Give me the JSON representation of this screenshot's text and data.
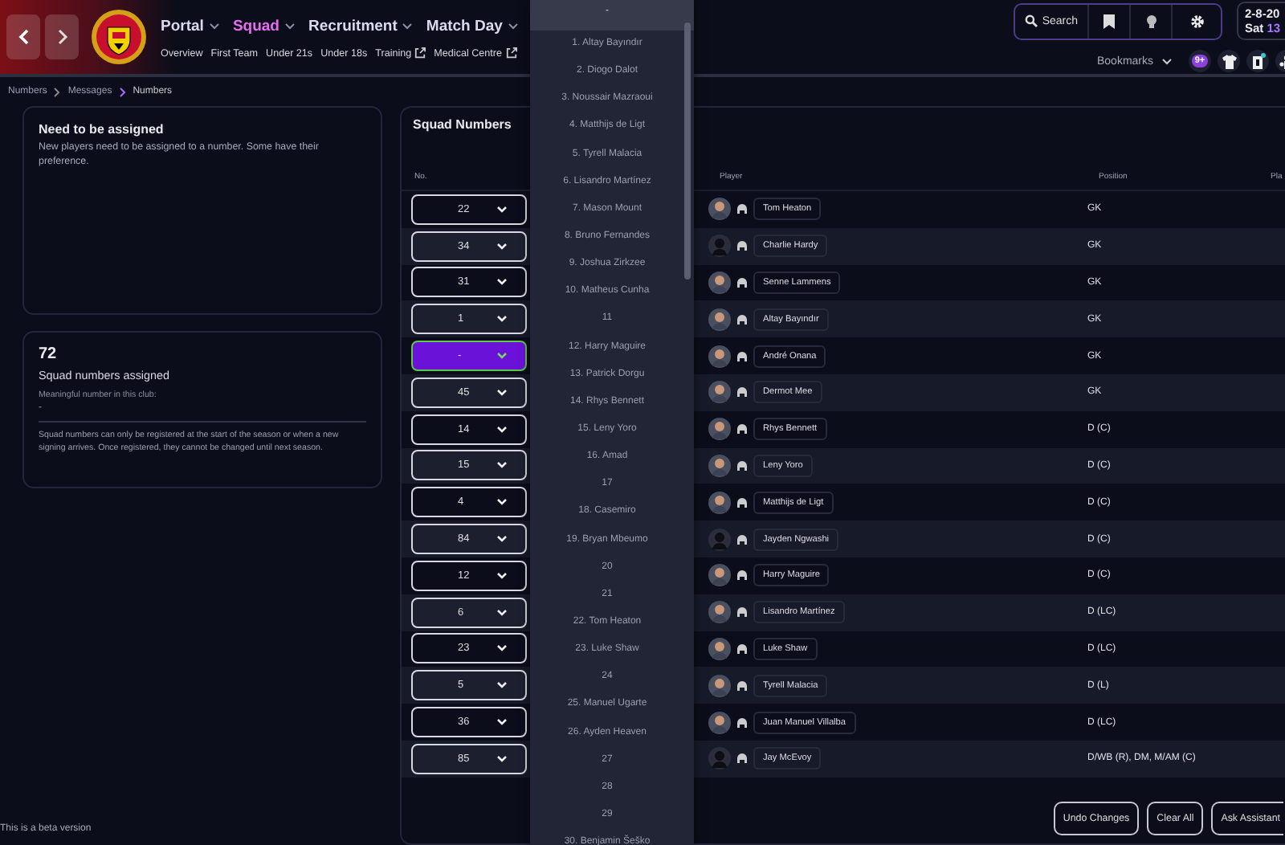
{
  "nav": [
    {
      "label": "Portal",
      "selected": false
    },
    {
      "label": "Squad",
      "selected": true
    },
    {
      "label": "Recruitment",
      "selected": false
    },
    {
      "label": "Match Day",
      "selected": false
    }
  ],
  "subnav": [
    {
      "label": "Overview",
      "external": false
    },
    {
      "label": "First Team",
      "external": false
    },
    {
      "label": "Under 21s",
      "external": false
    },
    {
      "label": "Under 18s",
      "external": false
    },
    {
      "label": "Training",
      "external": true
    },
    {
      "label": "Medical Centre",
      "external": true
    }
  ],
  "search": {
    "label": "Search"
  },
  "date": {
    "line1": "2-8-20",
    "day": "Sat",
    "time": "13"
  },
  "bookmarks": {
    "label": "Bookmarks"
  },
  "notification_badge": "9+",
  "breadcrumb": [
    "Numbers",
    "Messages",
    "Numbers"
  ],
  "assign_panel": {
    "title": "Need to be assigned",
    "text": "New players need to be assigned to a number. Some have their preference."
  },
  "stats_panel": {
    "count": "72",
    "label": "Squad numbers assigned",
    "meaningful_label": "Meaningful number in this club:",
    "meaningful_value": "-",
    "note": "Squad numbers can only be registered at the start of the season or when a new signing arrives. Once registered, they cannot be changed until next season."
  },
  "squad_table": {
    "title": "Squad Numbers",
    "columns": [
      "No.",
      "Player",
      "Position",
      "Pla"
    ],
    "rows": [
      {
        "number": "22",
        "selected": false,
        "player": "Tom Heaton",
        "position": "GK",
        "has_photo": true
      },
      {
        "number": "34",
        "selected": false,
        "player": "Charlie Hardy",
        "position": "GK",
        "has_photo": false
      },
      {
        "number": "31",
        "selected": false,
        "player": "Senne Lammens",
        "position": "GK",
        "has_photo": true
      },
      {
        "number": "1",
        "selected": false,
        "player": "Altay Bayındır",
        "position": "GK",
        "has_photo": true
      },
      {
        "number": "-",
        "selected": true,
        "player": "André Onana",
        "position": "GK",
        "has_photo": true
      },
      {
        "number": "45",
        "selected": false,
        "player": "Dermot Mee",
        "position": "GK",
        "has_photo": true
      },
      {
        "number": "14",
        "selected": false,
        "player": "Rhys Bennett",
        "position": "D (C)",
        "has_photo": true
      },
      {
        "number": "15",
        "selected": false,
        "player": "Leny Yoro",
        "position": "D (C)",
        "has_photo": true
      },
      {
        "number": "4",
        "selected": false,
        "player": "Matthijs de Ligt",
        "position": "D (C)",
        "has_photo": true
      },
      {
        "number": "84",
        "selected": false,
        "player": "Jayden Ngwashi",
        "position": "D (C)",
        "has_photo": false
      },
      {
        "number": "12",
        "selected": false,
        "player": "Harry Maguire",
        "position": "D (C)",
        "has_photo": true
      },
      {
        "number": "6",
        "selected": false,
        "player": "Lisandro Martínez",
        "position": "D (LC)",
        "has_photo": true
      },
      {
        "number": "23",
        "selected": false,
        "player": "Luke Shaw",
        "position": "D (LC)",
        "has_photo": true
      },
      {
        "number": "5",
        "selected": false,
        "player": "Tyrell Malacia",
        "position": "D (L)",
        "has_photo": true
      },
      {
        "number": "36",
        "selected": false,
        "player": "Juan Manuel Villalba",
        "position": "D (LC)",
        "has_photo": true
      },
      {
        "number": "85",
        "selected": false,
        "player": "Jay McEvoy",
        "position": "D/WB (R), DM, M/AM (C)",
        "has_photo": false
      }
    ]
  },
  "number_dropdown": {
    "items": [
      {
        "label": "-",
        "selected": true
      },
      {
        "label": "1. Altay Bayındır",
        "selected": false
      },
      {
        "label": "2. Diogo Dalot",
        "selected": false
      },
      {
        "label": "3. Noussair Mazraoui",
        "selected": false
      },
      {
        "label": "4. Matthijs de Ligt",
        "selected": false
      },
      {
        "label": "5. Tyrell Malacia",
        "selected": false
      },
      {
        "label": "6. Lisandro Martínez",
        "selected": false
      },
      {
        "label": "7. Mason Mount",
        "selected": false
      },
      {
        "label": "8. Bruno Fernandes",
        "selected": false
      },
      {
        "label": "9. Joshua Zirkzee",
        "selected": false
      },
      {
        "label": "10. Matheus Cunha",
        "selected": false
      },
      {
        "label": "11",
        "selected": false
      },
      {
        "label": "12. Harry Maguire",
        "selected": false
      },
      {
        "label": "13. Patrick Dorgu",
        "selected": false
      },
      {
        "label": "14. Rhys Bennett",
        "selected": false
      },
      {
        "label": "15. Leny Yoro",
        "selected": false
      },
      {
        "label": "16. Amad",
        "selected": false
      },
      {
        "label": "17",
        "selected": false
      },
      {
        "label": "18. Casemiro",
        "selected": false
      },
      {
        "label": "19. Bryan Mbeumo",
        "selected": false
      },
      {
        "label": "20",
        "selected": false
      },
      {
        "label": "21",
        "selected": false
      },
      {
        "label": "22. Tom Heaton",
        "selected": false
      },
      {
        "label": "23. Luke Shaw",
        "selected": false
      },
      {
        "label": "24",
        "selected": false
      },
      {
        "label": "25. Manuel Ugarte",
        "selected": false
      },
      {
        "label": "26. Ayden Heaven",
        "selected": false
      },
      {
        "label": "27",
        "selected": false
      },
      {
        "label": "28",
        "selected": false
      },
      {
        "label": "29",
        "selected": false
      },
      {
        "label": "30. Benjamin Šeško",
        "selected": false
      }
    ]
  },
  "buttons": [
    "Undo Changes",
    "Clear All",
    "Ask Assistant"
  ],
  "footer_note": "This is a beta version"
}
